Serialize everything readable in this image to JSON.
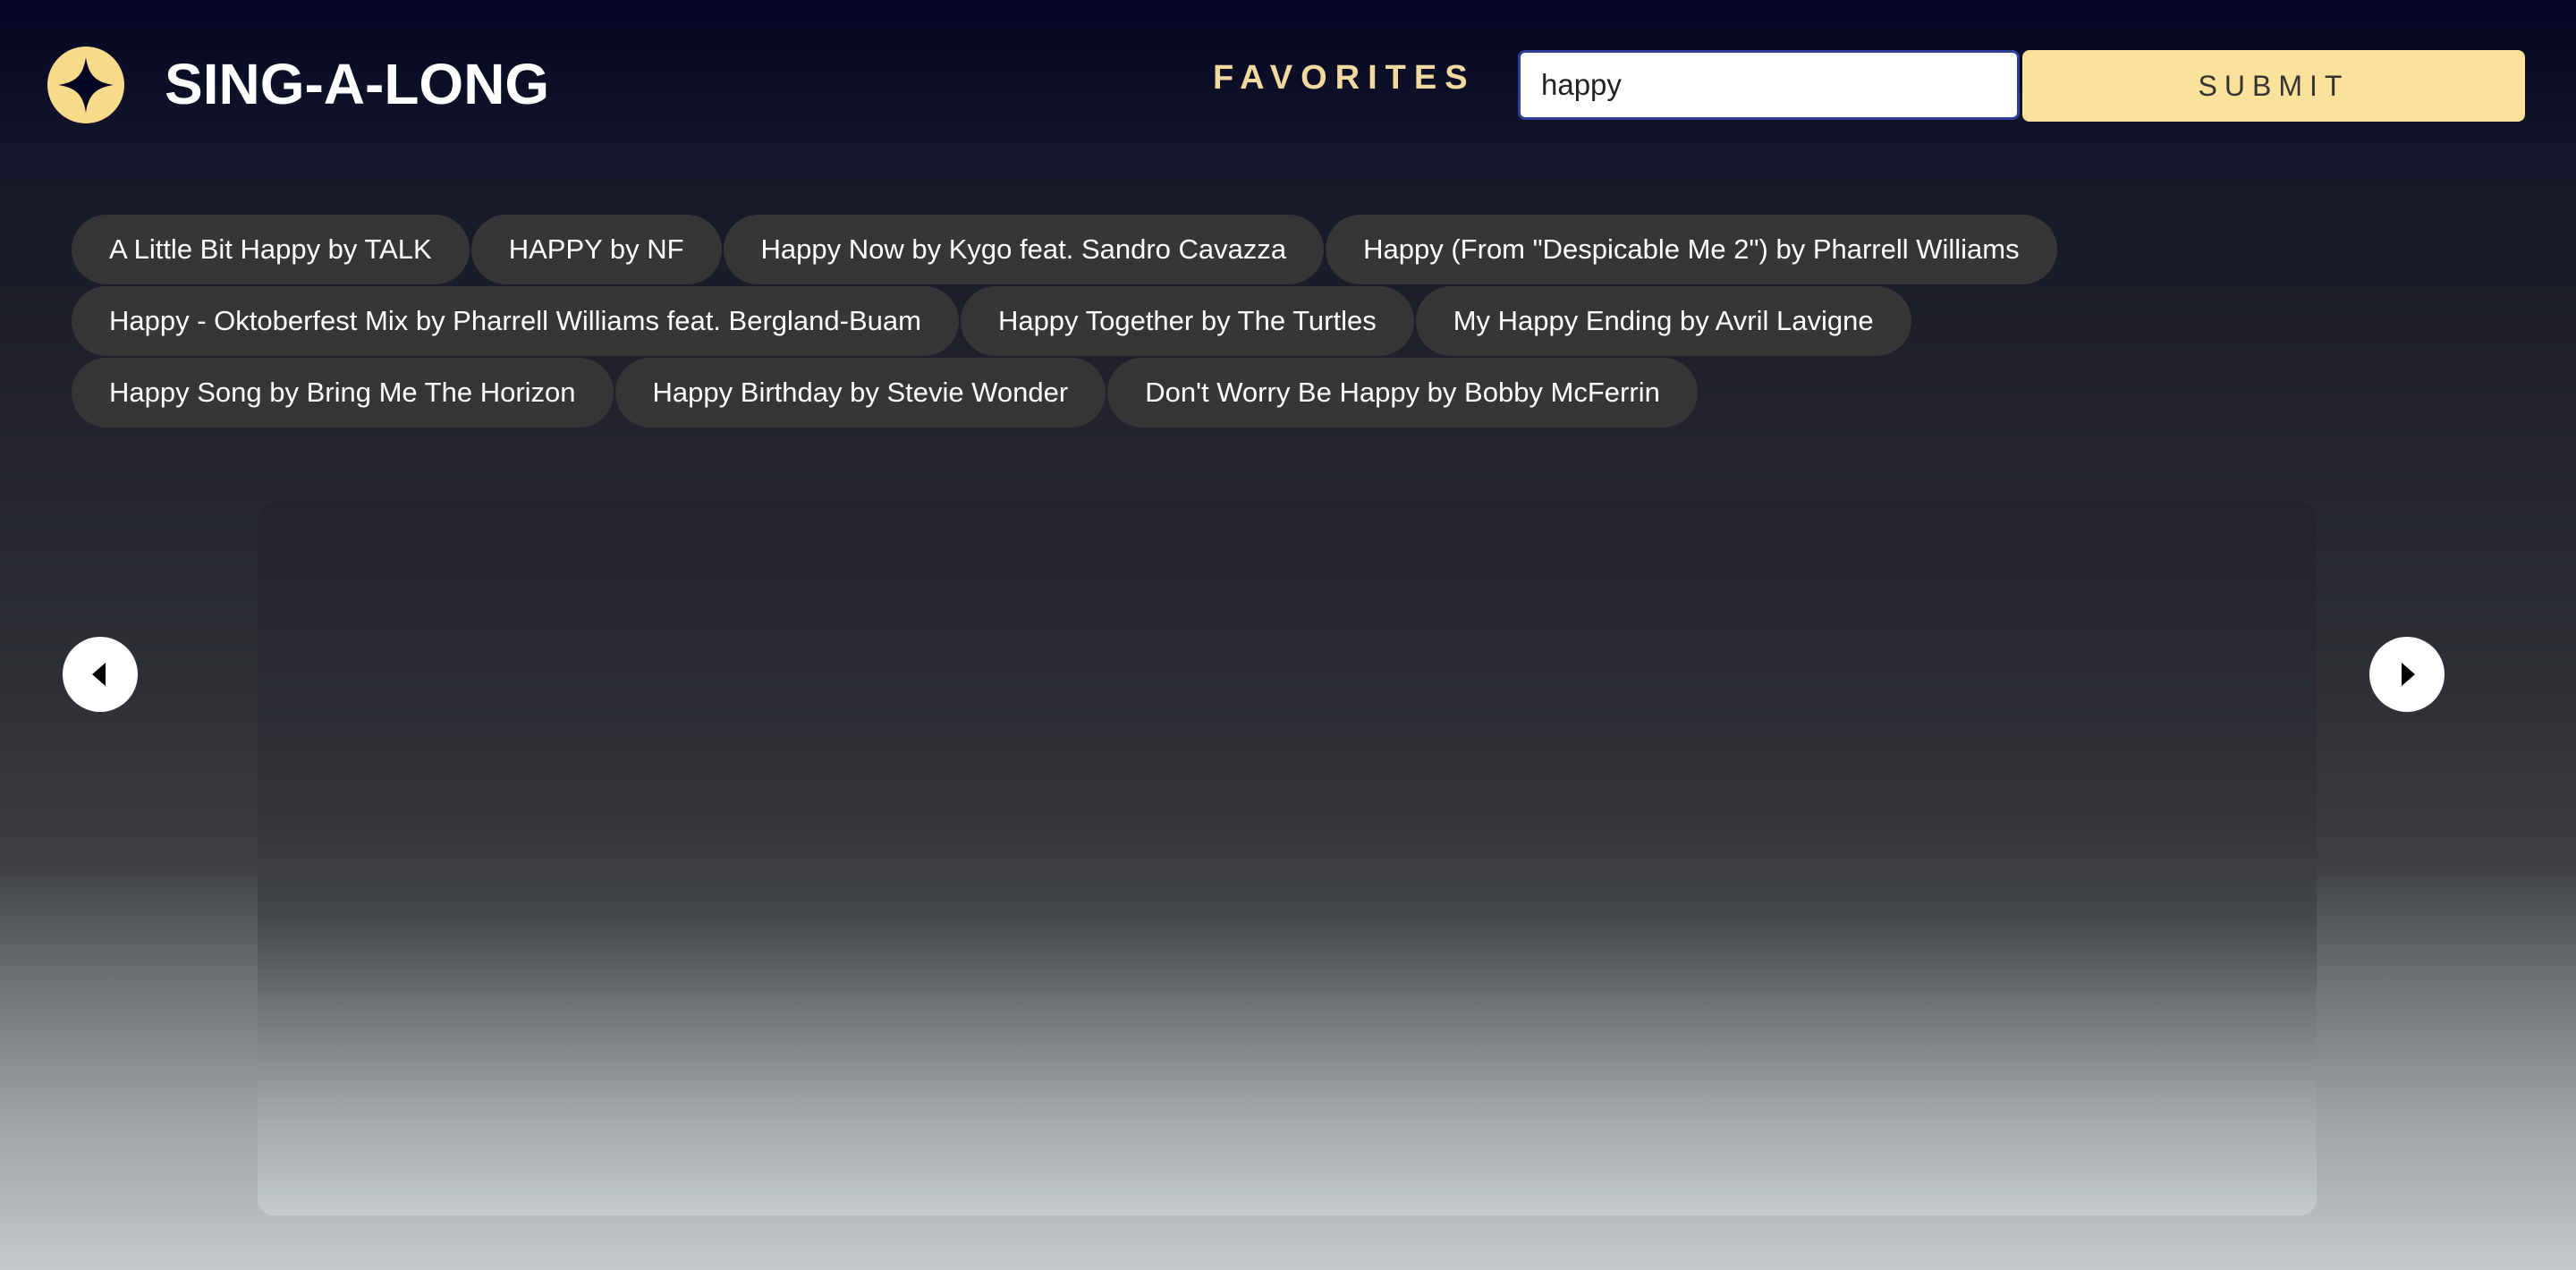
{
  "header": {
    "title": "SING-A-LONG",
    "logo_icon": "four-point-star-icon",
    "favorites_label": "FAVORITES",
    "search": {
      "value": "happy",
      "placeholder": ""
    },
    "submit_label": "SUBMIT"
  },
  "colors": {
    "accent": "#f8db8a",
    "favorites_text": "#f3d9a0",
    "chip_background": "#363636",
    "page_top": "#050524",
    "page_bottom": "#c2c9cc"
  },
  "results": [
    "A Little Bit Happy by TALK",
    "HAPPY by NF",
    "Happy Now by Kygo feat. Sandro Cavazza",
    "Happy (From \"Despicable Me 2\") by Pharrell Williams",
    "Happy - Oktoberfest Mix by Pharrell Williams feat. Bergland-Buam",
    "Happy Together by The Turtles",
    "My Happy Ending by Avril Lavigne",
    "Happy Song by Bring Me The Horizon",
    "Happy Birthday by Stevie Wonder",
    "Don't Worry Be Happy by Bobby McFerrin"
  ],
  "carousel": {
    "prev_icon": "triangle-left-icon",
    "next_icon": "triangle-right-icon"
  }
}
